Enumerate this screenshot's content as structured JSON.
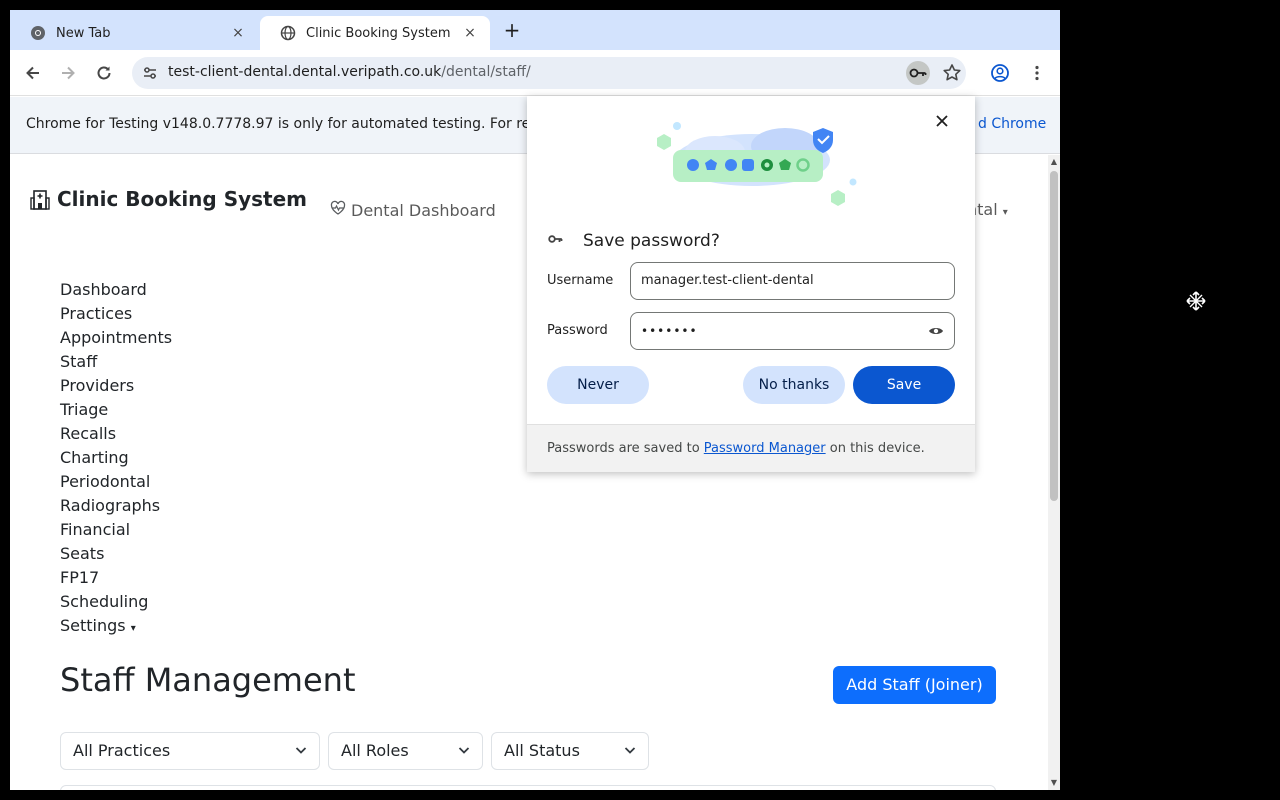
{
  "browser": {
    "tabs": [
      {
        "title": "New Tab",
        "close": "×"
      },
      {
        "title": "Clinic Booking System",
        "close": "×"
      }
    ],
    "new_tab_symbol": "+",
    "url_host": "test-client-dental.dental.veripath.co.uk",
    "url_path": "/dental/staff/",
    "infobar_text": "Chrome for Testing v148.0.7778.97 is only for automated testing. For re",
    "infobar_link": "d Chrome",
    "icons": {
      "back": "arrow-left-icon",
      "forward": "arrow-right-icon",
      "reload": "reload-icon",
      "site_info": "tune-icon",
      "password_key": "key-icon",
      "bookmark": "star-icon",
      "profile": "profile-icon",
      "menu": "kebab-menu-icon"
    }
  },
  "app": {
    "brand": "Clinic Booking System",
    "dashboard_link": "Dental Dashboard",
    "practice_dropdown": "ntal",
    "nav": [
      "Dashboard",
      "Practices",
      "Appointments",
      "Staff",
      "Providers",
      "Triage",
      "Recalls",
      "Charting",
      "Periodontal",
      "Radiographs",
      "Financial",
      "Seats",
      "FP17",
      "Scheduling",
      "Settings"
    ],
    "heading": "Staff Management",
    "add_button": "Add Staff (Joiner)",
    "filters": {
      "practices": "All Practices",
      "roles": "All Roles",
      "status": "All Status"
    }
  },
  "password_popup": {
    "title": "Save password?",
    "username_label": "Username",
    "username_value": "manager.test-client-dental",
    "password_label": "Password",
    "password_value": "•••••••",
    "never_button": "Never",
    "no_thanks_button": "No thanks",
    "save_button": "Save",
    "footer_prefix": "Passwords are saved to ",
    "footer_link": "Password Manager",
    "footer_suffix": " on this device."
  },
  "colors": {
    "tabstrip": "#d3e3fd",
    "primary": "#0d6efd",
    "chrome_blue": "#0b57d0"
  }
}
